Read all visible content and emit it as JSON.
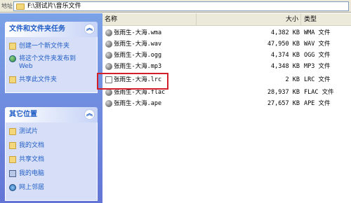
{
  "address_bar": {
    "label": "地址",
    "path": "F:\\测试片\\音乐文件"
  },
  "task_pane": {
    "file_tasks": {
      "title": "文件和文件夹任务",
      "collapse_glyph": "︽",
      "items": [
        {
          "label": "创建一个新文件夹",
          "icon": "folder-new-icon"
        },
        {
          "label_line1": "将这个文件夹发布到",
          "label_line2": "Web",
          "icon": "web-publish-icon"
        },
        {
          "label": "共享此文件夹",
          "icon": "share-folder-icon"
        }
      ]
    },
    "other_places": {
      "title": "其它位置",
      "collapse_glyph": "︽",
      "items": [
        {
          "label": "测试片",
          "icon": "folder-icon"
        },
        {
          "label": "我的文档",
          "icon": "my-documents-icon"
        },
        {
          "label": "共享文档",
          "icon": "shared-documents-icon"
        },
        {
          "label": "我的电脑",
          "icon": "my-computer-icon"
        },
        {
          "label": "网上邻居",
          "icon": "network-icon"
        }
      ]
    }
  },
  "file_list": {
    "columns": {
      "name": "名称",
      "size": "大小",
      "type": "类型"
    },
    "sort_indicator": "▲",
    "rows": [
      {
        "name": "张雨生-大海.wma",
        "size": "4,382 KB",
        "type": "WMA 文件"
      },
      {
        "name": "张雨生-大海.wav",
        "size": "47,950 KB",
        "type": "WAV 文件"
      },
      {
        "name": "张雨生-大海.ogg",
        "size": "4,374 KB",
        "type": "OGG 文件"
      },
      {
        "name": "张雨生-大海.mp3",
        "size": "4,348 KB",
        "type": "MP3 文件"
      },
      {
        "name": "张雨生-大海.lrc",
        "size": "2 KB",
        "type": "LRC 文件"
      },
      {
        "name": "张雨生-大海.flac",
        "size": "28,937 KB",
        "type": "FLAC 文件"
      },
      {
        "name": "张雨生-大海.ape",
        "size": "27,657 KB",
        "type": "APE 文件"
      }
    ]
  },
  "colors": {
    "highlight": "#d21f2a",
    "task_link": "#215dc6",
    "pane_bg": "#6e8de0"
  }
}
